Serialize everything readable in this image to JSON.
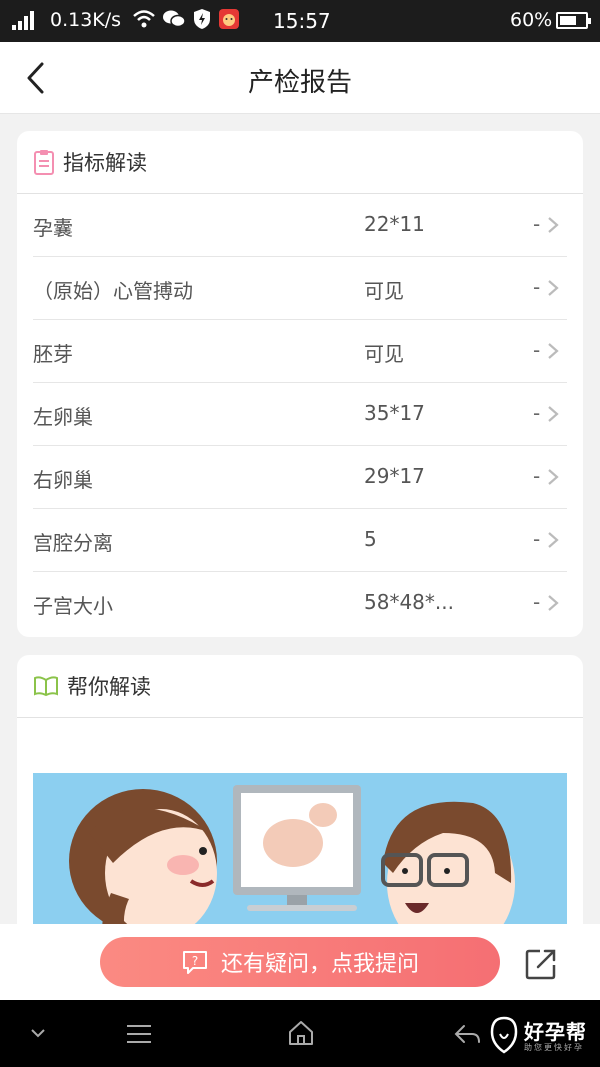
{
  "status_bar": {
    "net_speed": "0.13K/s",
    "time": "15:57",
    "battery": "60%",
    "icons": [
      "signal-icon",
      "wifi-icon",
      "wechat-icon",
      "shield-icon",
      "app-icon",
      "battery-icon"
    ]
  },
  "header": {
    "title": "产检报告",
    "back_icon": "chevron-left-icon"
  },
  "indicators": {
    "title": "指标解读",
    "icon": "clipboard-icon",
    "rows": [
      {
        "name": "孕囊",
        "value": "22*11",
        "extra": "-"
      },
      {
        "name": "（原始）心管搏动",
        "value": "可见",
        "extra": "-"
      },
      {
        "name": "胚芽",
        "value": "可见",
        "extra": "-"
      },
      {
        "name": "左卵巢",
        "value": "35*17",
        "extra": "-"
      },
      {
        "name": "右卵巢",
        "value": "29*17",
        "extra": "-"
      },
      {
        "name": "宫腔分离",
        "value": "5",
        "extra": "-"
      },
      {
        "name": "子宫大小",
        "value": "58*48*...",
        "extra": "-"
      }
    ]
  },
  "help": {
    "title": "帮你解读",
    "icon": "book-icon"
  },
  "action_bar": {
    "ask_label": "还有疑问，点我提问",
    "ask_icon": "question-bubble-icon",
    "share_icon": "share-icon"
  },
  "nav_bar": {
    "brand": "好孕帮",
    "tagline": "助您更快好孕"
  },
  "colors": {
    "accent": "#f5706f",
    "card_bg": "#ffffff",
    "page_bg": "#f2f2f2"
  }
}
